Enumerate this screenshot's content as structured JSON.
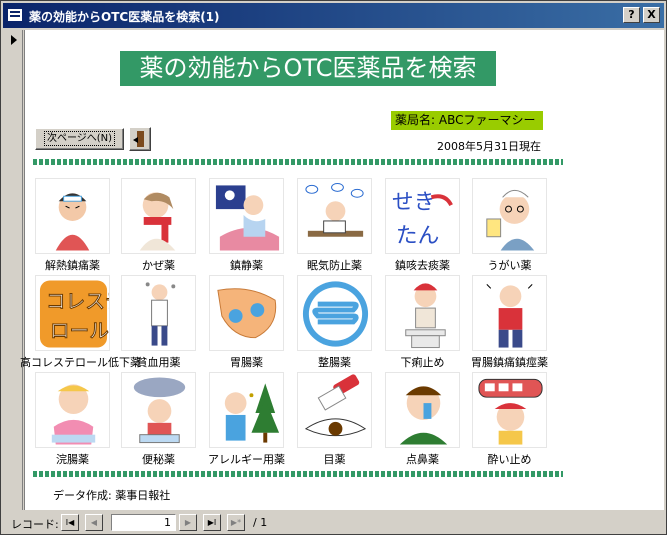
{
  "window": {
    "title": "薬の効能からOTC医薬品を検索(1)",
    "help_label": "?",
    "close_label": "X"
  },
  "form": {
    "heading": "薬の効能からOTC医薬品を検索",
    "pharmacy": "薬局名: ABCファーマシー",
    "date": "2008年5月31日現在",
    "next_button": "次ページへ(N)",
    "credit": "データ作成: 薬事日報社"
  },
  "categories": [
    {
      "label": "解熱鎮痛薬",
      "icon": "fever-headache-icon"
    },
    {
      "label": "かぜ薬",
      "icon": "cold-scarf-icon"
    },
    {
      "label": "鎮静薬",
      "icon": "sleepless-icon"
    },
    {
      "label": "眠気防止薬",
      "icon": "drowsy-icon"
    },
    {
      "label": "鎮咳去痰薬",
      "icon": "cough-text-icon"
    },
    {
      "label": "うがい薬",
      "icon": "gargle-icon"
    },
    {
      "label": "高コレステロール低下薬",
      "icon": "cholesterol-text-icon"
    },
    {
      "label": "貧血用薬",
      "icon": "anemia-icon"
    },
    {
      "label": "胃腸薬",
      "icon": "stomach-icon"
    },
    {
      "label": "整腸薬",
      "icon": "intestine-icon"
    },
    {
      "label": "下痢止め",
      "icon": "toilet-icon"
    },
    {
      "label": "胃腸鎮痛鎮痙薬",
      "icon": "stomachache-icon"
    },
    {
      "label": "浣腸薬",
      "icon": "baby-potty-icon"
    },
    {
      "label": "便秘薬",
      "icon": "constipation-icon"
    },
    {
      "label": "アレルギー用薬",
      "icon": "allergy-icon"
    },
    {
      "label": "目薬",
      "icon": "eye-drops-icon"
    },
    {
      "label": "点鼻薬",
      "icon": "nasal-spray-icon"
    },
    {
      "label": "酔い止め",
      "icon": "motion-sickness-icon"
    }
  ],
  "navbar": {
    "label": "レコード:",
    "current": "1",
    "of": "/ 1",
    "first": "I◀",
    "prev": "◀",
    "next": "▶",
    "last": "▶I",
    "new": "▶*"
  },
  "colors": {
    "accent_green": "#339966",
    "pharmacy_green": "#99cc00",
    "title_blue": "#0a246a"
  }
}
